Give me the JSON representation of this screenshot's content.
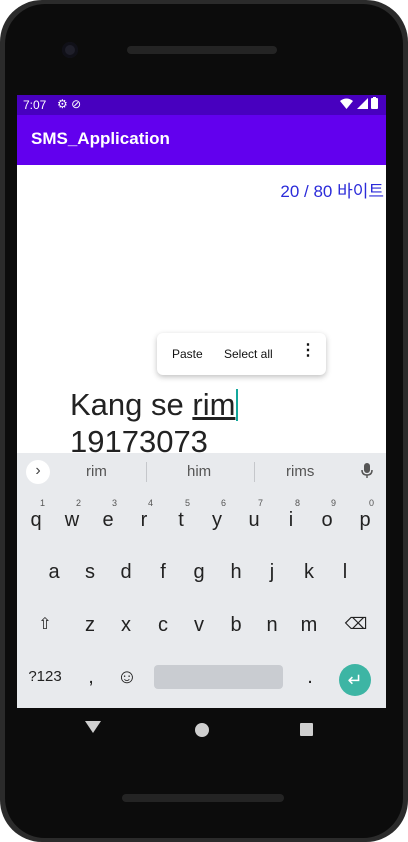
{
  "status_bar": {
    "time": "7:07",
    "left_icons": [
      "gear-icon",
      "do-not-disturb-icon"
    ],
    "right_icons": [
      "wifi-icon",
      "signal-icon",
      "battery-icon"
    ]
  },
  "app_bar": {
    "title": "SMS_Application"
  },
  "byte_counter": "20 / 80 바이트",
  "context_menu": {
    "paste": "Paste",
    "select_all": "Select all",
    "more": "⋮"
  },
  "message": {
    "line1_prefix": "Kang se ",
    "line1_word": "rim",
    "line2": "19173073"
  },
  "keyboard": {
    "suggestions": [
      "rim",
      "him",
      "rims"
    ],
    "row1": [
      {
        "k": "q",
        "h": "1"
      },
      {
        "k": "w",
        "h": "2"
      },
      {
        "k": "e",
        "h": "3"
      },
      {
        "k": "r",
        "h": "4"
      },
      {
        "k": "t",
        "h": "5"
      },
      {
        "k": "y",
        "h": "6"
      },
      {
        "k": "u",
        "h": "7"
      },
      {
        "k": "i",
        "h": "8"
      },
      {
        "k": "o",
        "h": "9"
      },
      {
        "k": "p",
        "h": "0"
      }
    ],
    "row2": [
      "a",
      "s",
      "d",
      "f",
      "g",
      "h",
      "j",
      "k",
      "l"
    ],
    "row3": [
      "z",
      "x",
      "c",
      "v",
      "b",
      "n",
      "m"
    ],
    "symbols_key": "?123",
    "comma_key": ",",
    "period_key": ".",
    "emoji_key": "☺",
    "enter_key": "↵",
    "shift_key": "⇧",
    "backspace_key": "⌫"
  },
  "colors": {
    "status_bar": "#4800bf",
    "app_bar": "#6200ee",
    "counter_text": "#2b2bd9",
    "caret": "#13a79b",
    "enter_key": "#3db5a4"
  }
}
